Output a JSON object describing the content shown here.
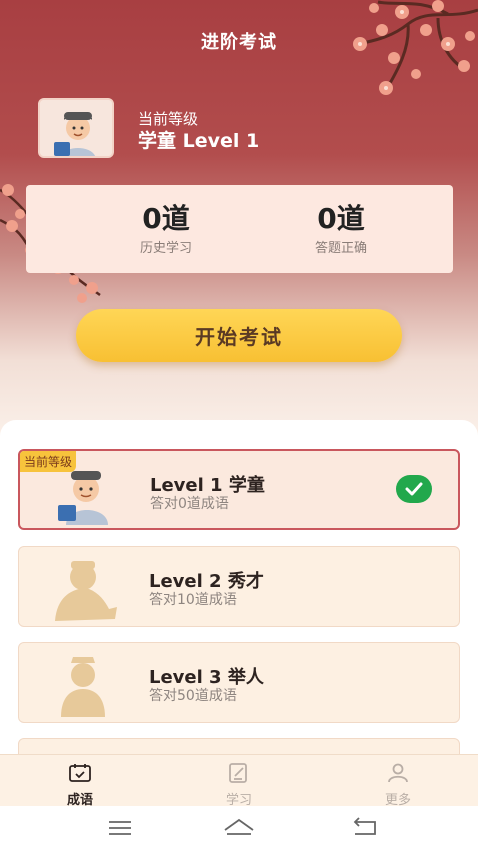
{
  "header": {
    "title": "进阶考试"
  },
  "profile": {
    "level_caption": "当前等级",
    "level_name": "学童 Level 1"
  },
  "stats": {
    "history": {
      "value": "0道",
      "label": "历史学习"
    },
    "correct": {
      "value": "0道",
      "label": "答题正确"
    }
  },
  "start_button": {
    "label": "开始考试"
  },
  "levels": [
    {
      "tag": "当前等级",
      "title": "Level 1 学童",
      "subtitle": "答对0道成语",
      "status": "current",
      "icon": "check-icon"
    },
    {
      "title": "Level 2 秀才",
      "subtitle": "答对10道成语",
      "status": "locked"
    },
    {
      "title": "Level 3 举人",
      "subtitle": "答对50道成语",
      "status": "locked"
    }
  ],
  "tabs": [
    {
      "label": "成语",
      "icon": "calendar-icon",
      "active": true
    },
    {
      "label": "学习",
      "icon": "edit-note-icon",
      "active": false
    },
    {
      "label": "更多",
      "icon": "user-icon",
      "active": false
    }
  ],
  "colors": {
    "header_red": "#a83f42",
    "accent_yellow": "#f8c033",
    "check_green": "#22a84c",
    "active_tab": "#2d2320",
    "inactive_tab": "#b9aea6"
  }
}
